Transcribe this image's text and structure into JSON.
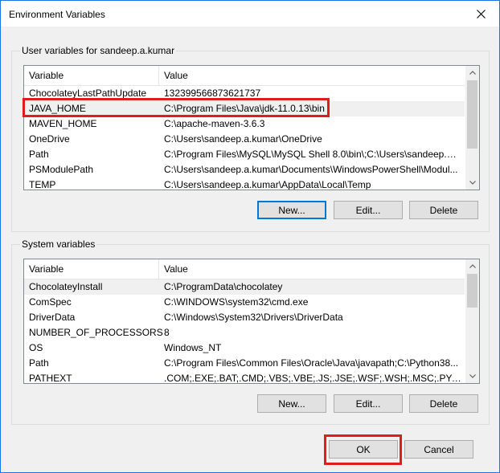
{
  "window": {
    "title": "Environment Variables"
  },
  "user_vars": {
    "label": "User variables for sandeep.a.kumar",
    "columns": [
      "Variable",
      "Value"
    ],
    "rows": [
      {
        "name": "ChocolateyLastPathUpdate",
        "value": "132399566873621737"
      },
      {
        "name": "JAVA_HOME",
        "value": "C:\\Program Files\\Java\\jdk-11.0.13\\bin"
      },
      {
        "name": "MAVEN_HOME",
        "value": "C:\\apache-maven-3.6.3"
      },
      {
        "name": "OneDrive",
        "value": "C:\\Users\\sandeep.a.kumar\\OneDrive"
      },
      {
        "name": "Path",
        "value": "C:\\Program Files\\MySQL\\MySQL Shell 8.0\\bin\\;C:\\Users\\sandeep.a...."
      },
      {
        "name": "PSModulePath",
        "value": "C:\\Users\\sandeep.a.kumar\\Documents\\WindowsPowerShell\\Modul..."
      },
      {
        "name": "TEMP",
        "value": "C:\\Users\\sandeep.a.kumar\\AppData\\Local\\Temp"
      }
    ],
    "buttons": {
      "new": "New...",
      "edit": "Edit...",
      "delete": "Delete"
    }
  },
  "system_vars": {
    "label": "System variables",
    "columns": [
      "Variable",
      "Value"
    ],
    "rows": [
      {
        "name": "ChocolateyInstall",
        "value": "C:\\ProgramData\\chocolatey"
      },
      {
        "name": "ComSpec",
        "value": "C:\\WINDOWS\\system32\\cmd.exe"
      },
      {
        "name": "DriverData",
        "value": "C:\\Windows\\System32\\Drivers\\DriverData"
      },
      {
        "name": "NUMBER_OF_PROCESSORS",
        "value": "8"
      },
      {
        "name": "OS",
        "value": "Windows_NT"
      },
      {
        "name": "Path",
        "value": "C:\\Program Files\\Common Files\\Oracle\\Java\\javapath;C:\\Python38..."
      },
      {
        "name": "PATHEXT",
        "value": ".COM;.EXE;.BAT;.CMD;.VBS;.VBE;.JS;.JSE;.WSF;.WSH;.MSC;.PY;.PYW"
      }
    ],
    "buttons": {
      "new": "New...",
      "edit": "Edit...",
      "delete": "Delete"
    }
  },
  "footer": {
    "ok": "OK",
    "cancel": "Cancel"
  },
  "colors": {
    "highlight": "#e01c1c",
    "accent": "#0078d7",
    "border": "#1a73e8"
  },
  "icons": {
    "close": "close-icon",
    "scroll_up": "chevron-up-icon",
    "scroll_down": "chevron-down-icon"
  }
}
